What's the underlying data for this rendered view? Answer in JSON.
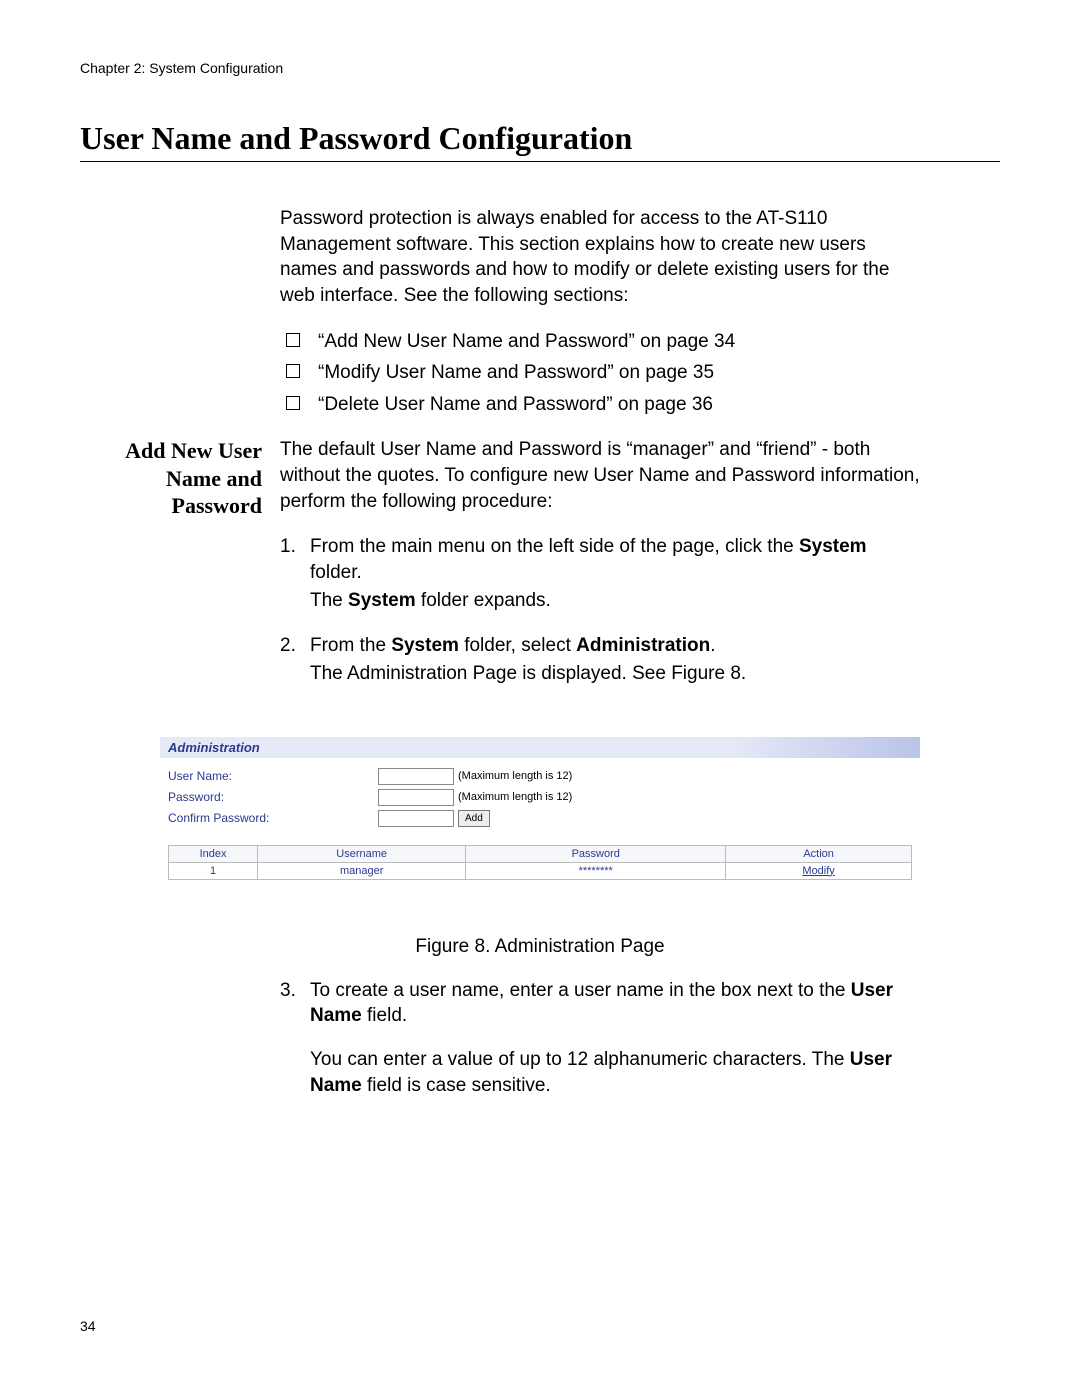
{
  "header": {
    "chapter": "Chapter 2: System Configuration"
  },
  "title": "User Name and Password Configuration",
  "intro": "Password protection is always enabled for access to the AT-S110 Management software. This section explains how to create new users names and passwords and how to modify or delete existing users for the web interface. See the following sections:",
  "bullets": [
    "“Add New User Name and Password” on page 34",
    "“Modify User Name and Password” on page 35",
    "“Delete User Name and Password” on page 36"
  ],
  "subsection_title": "Add New User Name and Password",
  "subsection_intro": "The default User Name and Password is “manager” and “friend” - both without the quotes. To configure new User Name and Password information, perform the following procedure:",
  "steps": {
    "s1_num": "1.",
    "s1_a": "From the main menu on the left side of the page, click the ",
    "s1_bold": "System",
    "s1_b": " folder.",
    "s1_sub_a": "The ",
    "s1_sub_bold": "System",
    "s1_sub_b": " folder expands.",
    "s2_num": "2.",
    "s2_a": "From the ",
    "s2_bold1": "System",
    "s2_b": " folder, select ",
    "s2_bold2": "Administration",
    "s2_c": ".",
    "s2_sub": "The Administration Page is displayed. See Figure 8.",
    "s3_num": "3.",
    "s3_a": "To create a user name, enter a user name in the box next to the ",
    "s3_bold": "User Name",
    "s3_b": " field.",
    "s3_note_a": "You can enter a value of up to 12 alphanumeric characters. The ",
    "s3_note_bold": "User Name",
    "s3_note_b": " field is case sensitive."
  },
  "admin": {
    "title": "Administration",
    "labels": {
      "username": "User Name:",
      "password": "Password:",
      "confirm": "Confirm Password:"
    },
    "hint": "(Maximum length is 12)",
    "add_button": "Add",
    "table": {
      "headers": [
        "Index",
        "Username",
        "Password",
        "Action"
      ],
      "row": {
        "index": "1",
        "username": "manager",
        "password": "********",
        "action": "Modify"
      }
    }
  },
  "figure_caption": "Figure 8. Administration Page",
  "page_number": "34"
}
